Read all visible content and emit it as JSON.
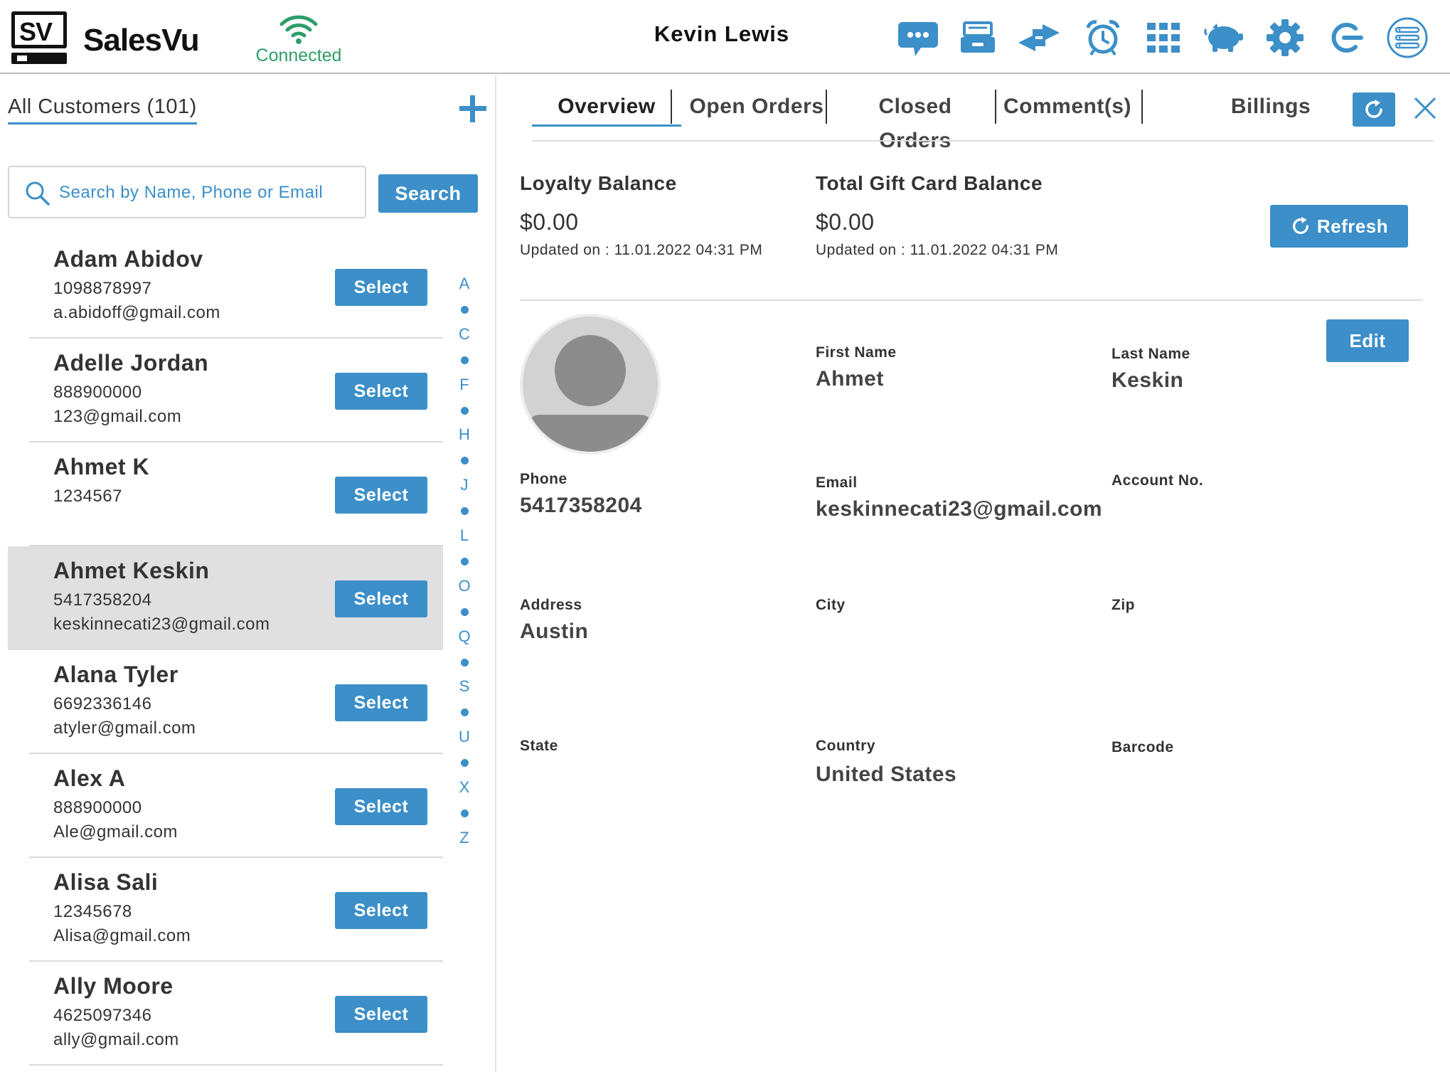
{
  "header": {
    "brand": "SalesVu",
    "logo_text": "SV",
    "connection_status": "Connected",
    "user_name": "Kevin Lewis",
    "icons": [
      "chat-icon",
      "cash-drawer-icon",
      "transfer-icon",
      "alarm-clock-icon",
      "grid-apps-icon",
      "piggy-bank-icon",
      "gear-icon",
      "logout-icon",
      "menu-list-icon"
    ]
  },
  "colors": {
    "accent": "#3c8fc8",
    "connected": "#2e9e6a",
    "selected_row": "#e0e0e0"
  },
  "customers": {
    "title": "All Customers (101)",
    "search_placeholder": "Search by Name, Phone or Email",
    "search_button": "Search",
    "select_label": "Select",
    "list": [
      {
        "name": "Adam Abidov",
        "phone": "1098878997",
        "email": "a.abidoff@gmail.com",
        "selected": false
      },
      {
        "name": "Adelle Jordan",
        "phone": "888900000",
        "email": "123@gmail.com",
        "selected": false
      },
      {
        "name": "Ahmet K",
        "phone": "1234567",
        "email": "",
        "selected": false
      },
      {
        "name": "Ahmet Keskin",
        "phone": "5417358204",
        "email": "keskinnecati23@gmail.com",
        "selected": true
      },
      {
        "name": "Alana Tyler",
        "phone": "6692336146",
        "email": "atyler@gmail.com",
        "selected": false
      },
      {
        "name": "Alex A",
        "phone": "888900000",
        "email": "Ale@gmail.com",
        "selected": false
      },
      {
        "name": "Alisa Sali",
        "phone": "12345678",
        "email": "Alisa@gmail.com",
        "selected": false
      },
      {
        "name": "Ally Moore",
        "phone": "4625097346",
        "email": "ally@gmail.com",
        "selected": false
      }
    ],
    "alphabet_index": [
      "A",
      "C",
      "F",
      "H",
      "J",
      "L",
      "O",
      "Q",
      "S",
      "U",
      "X",
      "Z"
    ]
  },
  "tabs": {
    "overview": "Overview",
    "open_orders": "Open Orders",
    "closed_orders": "Closed Orders",
    "comments": "Comment(s)",
    "billings": "Billings",
    "active": "overview"
  },
  "balances": {
    "loyalty_label": "Loyalty Balance",
    "loyalty_amount": "$0.00",
    "loyalty_updated": "Updated on :  11.01.2022 04:31 PM",
    "gift_label": "Total Gift Card Balance",
    "gift_amount": "$0.00",
    "gift_updated": "Updated on :  11.01.2022 04:31 PM",
    "refresh_label": "Refresh"
  },
  "details": {
    "edit_label": "Edit",
    "first_name_label": "First Name",
    "first_name": "Ahmet",
    "last_name_label": "Last Name",
    "last_name": "Keskin",
    "phone_label": "Phone",
    "phone": "5417358204",
    "email_label": "Email",
    "email": "keskinnecati23@gmail.com",
    "account_label": "Account No.",
    "account": "",
    "address_label": "Address",
    "address": "Austin",
    "city_label": "City",
    "city": "",
    "zip_label": "Zip",
    "zip": "",
    "state_label": "State",
    "state": "",
    "country_label": "Country",
    "country": "United States",
    "barcode_label": "Barcode",
    "barcode": ""
  }
}
